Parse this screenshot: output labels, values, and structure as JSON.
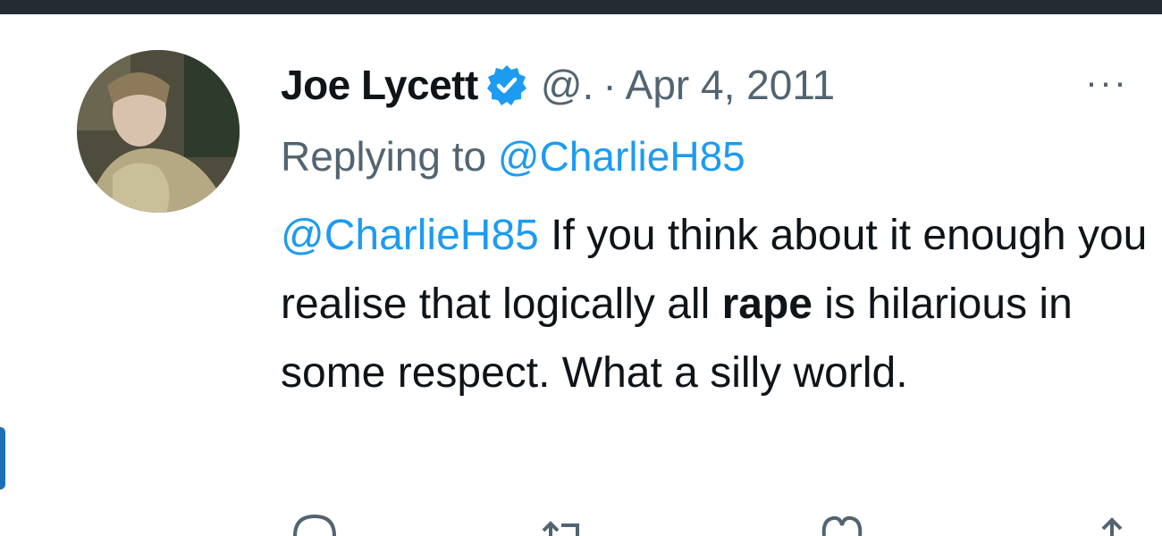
{
  "tweet": {
    "author_name": "Joe Lycett",
    "handle": "@.",
    "separator": "·",
    "date": "Apr 4, 2011",
    "more_label": "···",
    "reply_prefix": "Replying to",
    "reply_to": "@CharlieH85",
    "text": {
      "mention": "@CharlieH85",
      "part1": " If you think about it enough you realise that logically all ",
      "bold_word": "rape",
      "part2": " is hilarious in some respect. What a silly world."
    }
  },
  "icons": {
    "verified": "verified-badge-icon",
    "reply": "reply-icon",
    "retweet": "retweet-icon",
    "like": "like-icon",
    "share": "share-icon"
  },
  "colors": {
    "text": "#0f1419",
    "secondary": "#536471",
    "link": "#1d9bf0",
    "verified": "#1d9bf0",
    "top_bar": "#252b33"
  }
}
